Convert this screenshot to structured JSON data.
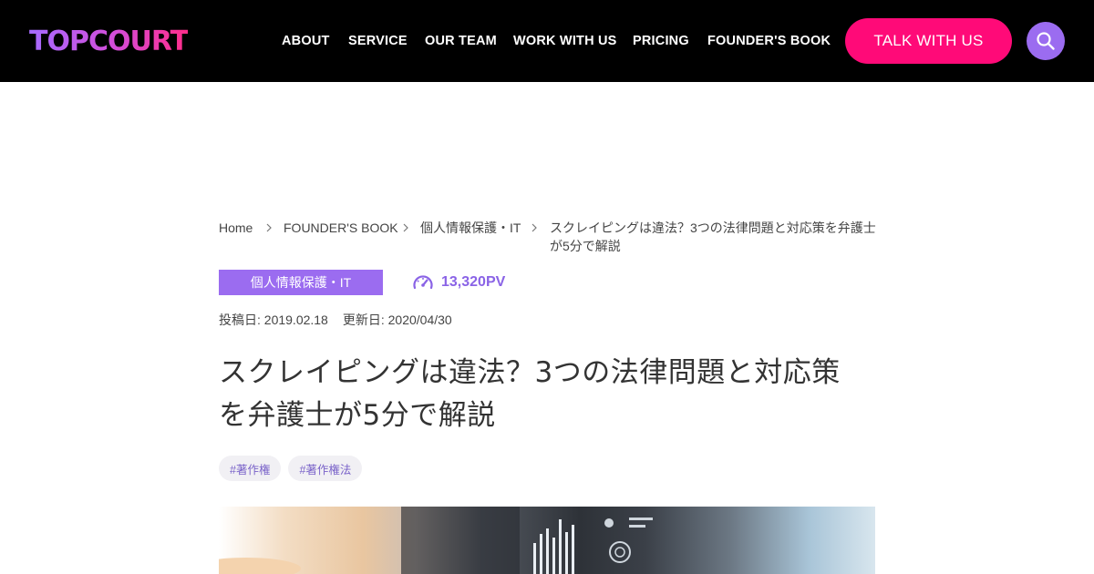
{
  "header": {
    "logo": "TOPCOURT",
    "nav": [
      "ABOUT",
      "SERVICE",
      "OUR TEAM",
      "WORK WITH US",
      "PRICING",
      "FOUNDER'S BOOK"
    ],
    "cta_label": "TALK WITH US",
    "search_icon": "search-icon",
    "colors": {
      "background": "#000000",
      "cta": "#ff0a78",
      "search": "#9b6cf0"
    }
  },
  "breadcrumb": {
    "items": [
      "Home",
      "FOUNDER'S BOOK",
      "個人情報保護・IT"
    ],
    "current": "スクレイピングは違法？3つの法律問題と対応策を弁護士が5分で解説"
  },
  "article": {
    "category": "個人情報保護・IT",
    "pageviews": "13,320PV",
    "posted": "投稿日: 2019.02.18",
    "updated": "更新日: 2020/04/30",
    "title_line1": "スクレイピングは違法？3つの法律問題と対応策",
    "title_line2": "を弁護士が5分で解説",
    "tags": [
      "#著作権",
      "#著作権法"
    ],
    "accent_color": "#9b6cf0"
  }
}
